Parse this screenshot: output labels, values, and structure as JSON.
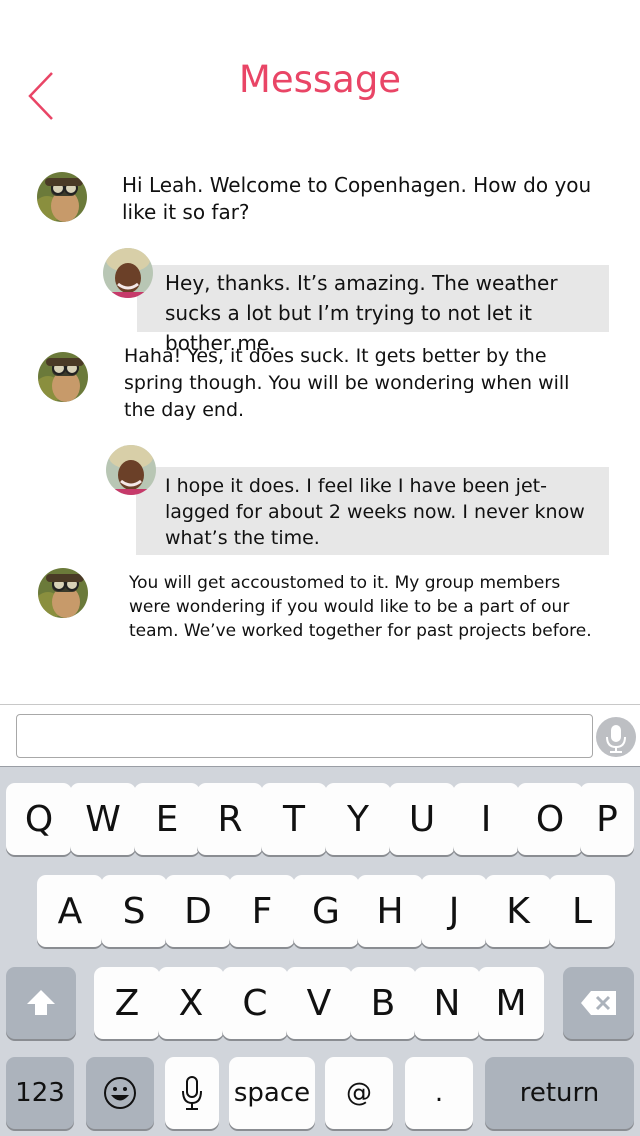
{
  "header": {
    "title": "Message",
    "back_icon": "chevron-left-icon",
    "accent_color": "#e94566"
  },
  "messages": [
    {
      "sender": "other",
      "avatar": "avatar-aviator-goggles",
      "text": "Hi Leah. Welcome to Copenhagen. How do you like it so far?"
    },
    {
      "sender": "me",
      "avatar": "avatar-leah",
      "text": "Hey, thanks. It’s amazing. The weather sucks a lot but I’m trying to not let it bother me."
    },
    {
      "sender": "other",
      "avatar": "avatar-aviator-goggles",
      "text": "Haha! Yes, it does suck. It gets better by the spring though. You will be wondering when will the day end."
    },
    {
      "sender": "me",
      "avatar": "avatar-leah",
      "text": "I hope it does. I feel like I have been jet-lagged for about 2 weeks now. I never know what’s the time."
    },
    {
      "sender": "other",
      "avatar": "avatar-aviator-goggles",
      "text": "You will get accoustomed to it. My group members were wondering if you would like to be a part of our team. We’ve worked together for past projects before."
    }
  ],
  "input": {
    "value": "",
    "placeholder": "",
    "mic_icon": "microphone-icon"
  },
  "keyboard": {
    "row1": [
      "Q",
      "W",
      "E",
      "R",
      "T",
      "Y",
      "U",
      "I",
      "O",
      "P"
    ],
    "row2": [
      "A",
      "S",
      "D",
      "F",
      "G",
      "H",
      "J",
      "K",
      "L"
    ],
    "row3": [
      "Z",
      "X",
      "C",
      "V",
      "B",
      "N",
      "M"
    ],
    "numbers_label": "123",
    "space_label": "space",
    "at_label": "@",
    "period_label": ".",
    "return_label": "return",
    "shift_icon": "shift-arrow-icon",
    "delete_icon": "backspace-icon",
    "emoji_icon": "emoji-face-icon",
    "dictation_icon": "microphone-icon",
    "key_color": "#fdfdfd",
    "function_key_color": "#acb3bc",
    "background_color": "#d1d5db"
  }
}
